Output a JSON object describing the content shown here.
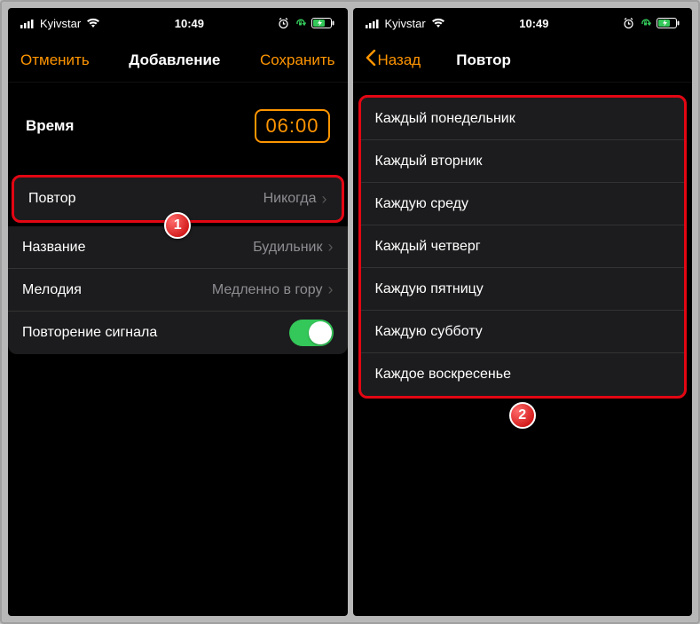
{
  "status": {
    "carrier": "Kyivstar",
    "time": "10:49"
  },
  "left": {
    "nav": {
      "cancel": "Отменить",
      "title": "Добавление",
      "save": "Сохранить"
    },
    "time": {
      "label": "Время",
      "value": "06:00"
    },
    "rows": {
      "repeat": {
        "label": "Повтор",
        "value": "Никогда"
      },
      "name": {
        "label": "Название",
        "value": "Будильник"
      },
      "sound": {
        "label": "Мелодия",
        "value": "Медленно в гору"
      },
      "snooze": {
        "label": "Повторение сигнала"
      }
    },
    "badge": "1"
  },
  "right": {
    "nav": {
      "back": "Назад",
      "title": "Повтор"
    },
    "days": [
      "Каждый понедельник",
      "Каждый вторник",
      "Каждую среду",
      "Каждый четверг",
      "Каждую пятницу",
      "Каждую субботу",
      "Каждое воскресенье"
    ],
    "badge": "2"
  }
}
